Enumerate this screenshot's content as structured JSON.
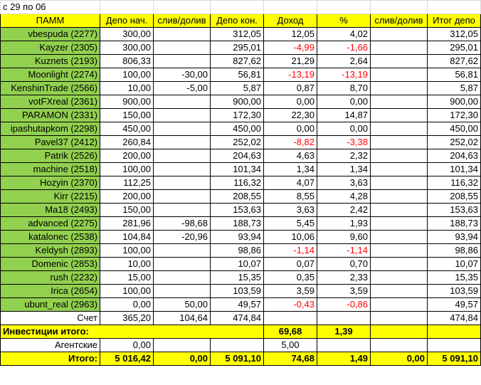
{
  "title": "с 29 по 06",
  "headers": [
    "ПАММ",
    "Депо нач.",
    "слив/долив",
    "Депо кон.",
    "Доход",
    "%",
    "слив/долив",
    "Итог депо"
  ],
  "rows": [
    [
      "vbespuda (2277)",
      "300,00",
      "",
      "312,05",
      "12,05",
      "4,02",
      "",
      "312,05"
    ],
    [
      "Kayzer (2305)",
      "300,00",
      "",
      "295,01",
      "-4,99",
      "-1,66",
      "",
      "295,01"
    ],
    [
      "Kuznets (2193)",
      "806,33",
      "",
      "827,62",
      "21,29",
      "2,64",
      "",
      "827,62"
    ],
    [
      "Moonlight (2274)",
      "100,00",
      "-30,00",
      "56,81",
      "-13,19",
      "-13,19",
      "",
      "56,81"
    ],
    [
      "KenshinTrade (2566)",
      "10,00",
      "-5,00",
      "5,87",
      "0,87",
      "8,70",
      "",
      "5,87"
    ],
    [
      "votFXreal (2361)",
      "900,00",
      "",
      "900,00",
      "0,00",
      "0,00",
      "",
      "900,00"
    ],
    [
      "PARAMON (2331)",
      "150,00",
      "",
      "172,30",
      "22,30",
      "14,87",
      "",
      "172,30"
    ],
    [
      "ipashutapkom (2298)",
      "450,00",
      "",
      "450,00",
      "0,00",
      "0,00",
      "",
      "450,00"
    ],
    [
      "Pavel37 (2412)",
      "260,84",
      "",
      "252,02",
      "-8,82",
      "-3,38",
      "",
      "252,02"
    ],
    [
      "Patrik (2526)",
      "200,00",
      "",
      "204,63",
      "4,63",
      "2,32",
      "",
      "204,63"
    ],
    [
      "machine (2518)",
      "100,00",
      "",
      "101,34",
      "1,34",
      "1,34",
      "",
      "101,34"
    ],
    [
      "Hozyin (2370)",
      "112,25",
      "",
      "116,32",
      "4,07",
      "3,63",
      "",
      "116,32"
    ],
    [
      "Kirr (2215)",
      "200,00",
      "",
      "208,55",
      "8,55",
      "4,28",
      "",
      "208,55"
    ],
    [
      "Ma18 (2493)",
      "150,00",
      "",
      "153,63",
      "3,63",
      "2,42",
      "",
      "153,63"
    ],
    [
      "advanced (2275)",
      "281,96",
      "-98,68",
      "188,73",
      "5,45",
      "1,93",
      "",
      "188,73"
    ],
    [
      "katalonec (2538)",
      "104,84",
      "-20,96",
      "93,94",
      "10,06",
      "9,60",
      "",
      "93,94"
    ],
    [
      "Keldysh (2893)",
      "100,00",
      "",
      "98,86",
      "-1,14",
      "-1,14",
      "",
      "98,86"
    ],
    [
      "Domenic (2853)",
      "10,00",
      "",
      "10,07",
      "0,07",
      "0,70",
      "",
      "10,07"
    ],
    [
      "rush (2232)",
      "15,00",
      "",
      "15,35",
      "0,35",
      "2,33",
      "",
      "15,35"
    ],
    [
      "Irica (2654)",
      "100,00",
      "",
      "103,59",
      "3,59",
      "3,59",
      "",
      "103,59"
    ],
    [
      "ubunt_real (2963)",
      "0,00",
      "50,00",
      "49,57",
      "-0,43",
      "-0,86",
      "",
      "49,57"
    ]
  ],
  "account_row": [
    "Счет",
    "365,20",
    "104,64",
    "474,84",
    "",
    "",
    "",
    "474,84"
  ],
  "investments": {
    "label": "Инвестиции итого:",
    "income": "69,68",
    "percent": "1,39"
  },
  "agency": {
    "label": "Агентские",
    "start": "0,00",
    "income": "5,00"
  },
  "totals": [
    "Итого:",
    "5 016,42",
    "0,00",
    "5 091,10",
    "74,68",
    "1,49",
    "0,00",
    "5 091,10"
  ],
  "colors": {
    "green": "#92d050",
    "yellow": "#ffff00",
    "negative": "#ff0000"
  }
}
